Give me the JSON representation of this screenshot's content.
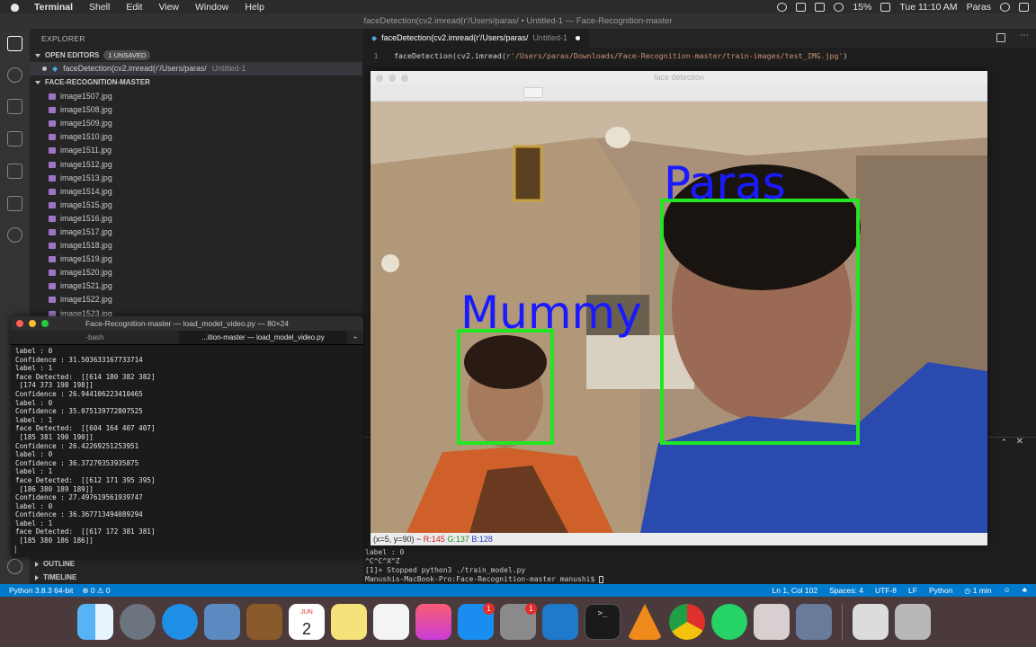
{
  "menubar": {
    "app": "Terminal",
    "items": [
      "Shell",
      "Edit",
      "View",
      "Window",
      "Help"
    ],
    "battery": "15%",
    "clock": "Tue 11:10 AM",
    "user": "Paras"
  },
  "window_title": "faceDetection(cv2.imread(r'/Users/paras/ • Untitled-1 — Face-Recognition-master",
  "sidebar": {
    "header": "EXPLORER",
    "open_editors_label": "OPEN EDITORS",
    "unsaved_badge": "1 UNSAVED",
    "open_editor_name": "faceDetection(cv2.imread(r'/Users/paras/",
    "open_editor_sub": "Untitled-1",
    "project_label": "FACE-RECOGNITION-MASTER",
    "files": [
      "image1507.jpg",
      "image1508.jpg",
      "image1509.jpg",
      "image1510.jpg",
      "image1511.jpg",
      "image1512.jpg",
      "image1513.jpg",
      "image1514.jpg",
      "image1515.jpg",
      "image1516.jpg",
      "image1517.jpg",
      "image1518.jpg",
      "image1519.jpg",
      "image1520.jpg",
      "image1521.jpg",
      "image1522.jpg",
      "image1523.jpg"
    ],
    "outline_label": "OUTLINE",
    "timeline_label": "TIMELINE"
  },
  "editor": {
    "tab_name": "faceDetection(cv2.imread(r'/Users/paras/",
    "tab_sub": "Untitled-1",
    "line_number": "1",
    "code_prefix": "faceDetection(cv2.imread(",
    "code_string": "r'/Users/paras/Downloads/Face-Recognition-master/train-images/test_IMG.jpg'",
    "code_suffix": ")"
  },
  "cv_window": {
    "title": "face detection",
    "labels": [
      "Paras",
      "Mummy"
    ],
    "status_prefix": "(x=5, y=90) ~",
    "r": "R:145",
    "g": "G:137",
    "b": "B:128"
  },
  "terminal": {
    "title": "Face-Recognition-master — load_model_video.py — 80×24",
    "tab1": "-bash",
    "tab2_prefix": "...ition-master — ",
    "tab2_name": "load_model_video.py",
    "lines": [
      "label : 0",
      "Confidence : 31.503633167733714",
      "label : 1",
      "face Detected:  [[614 180 382 382]",
      " [174 373 198 198]]",
      "Confidence : 26.944106223410465",
      "label : 0",
      "Confidence : 35.075139772807525",
      "label : 1",
      "face Detected:  [[604 164 407 407]",
      " [185 381 190 190]]",
      "Confidence : 26.42269251253951",
      "label : 0",
      "Confidence : 36.37279353935875",
      "label : 1",
      "face Detected:  [[612 171 395 395]",
      " [186 380 189 189]]",
      "Confidence : 27.497619561939747",
      "label : 0",
      "Confidence : 36.367713494089294",
      "label : 1",
      "face Detected:  [[617 172 381 381]",
      " [185 380 186 186]]",
      "▏"
    ]
  },
  "vs_terminal": {
    "lines": [
      "label : 0",
      "^C^C^X^Z",
      "[1]+  Stopped                 python3 ./train_model.py",
      "Manushis-MacBook-Pro:Face-Recognition-master manushi$ "
    ]
  },
  "statusbar": {
    "python": "Python 3.8.3 64-bit",
    "problems": "⊗ 0 ⚠ 0",
    "position": "Ln 1, Col 102",
    "spaces": "Spaces: 4",
    "encoding": "UTF-8",
    "eol": "LF",
    "language": "Python",
    "time": "1 min"
  },
  "dock": {
    "calendar_month": "JUN",
    "calendar_day": "2",
    "badge_appstore": "1",
    "badge_prefs": "1"
  },
  "colors": {
    "box": "#22e622",
    "label": "#1a1aff",
    "statusbar": "#007acc"
  }
}
